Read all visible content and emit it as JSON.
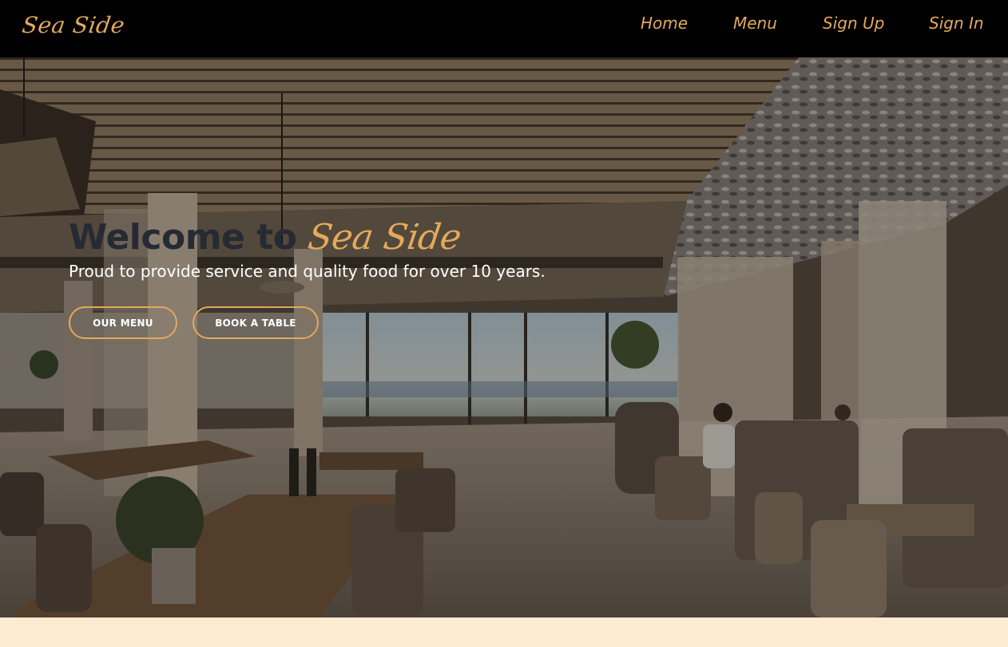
{
  "brand": "Sea Side",
  "nav": {
    "home": "Home",
    "menu": "Menu",
    "signup": "Sign Up",
    "signin": "Sign In"
  },
  "hero": {
    "title_prefix": "Welcome to",
    "title_accent": "Sea Side",
    "subtitle": "Proud to provide service and quality food for over 10 years.",
    "buttons": {
      "our_menu": "OUR MENU",
      "book_table": "BOOK A TABLE"
    }
  },
  "colors": {
    "accent": "#E3A95B",
    "navbar": "#000000",
    "page_bg": "#FCEBD0",
    "title_dark": "#262A33"
  }
}
